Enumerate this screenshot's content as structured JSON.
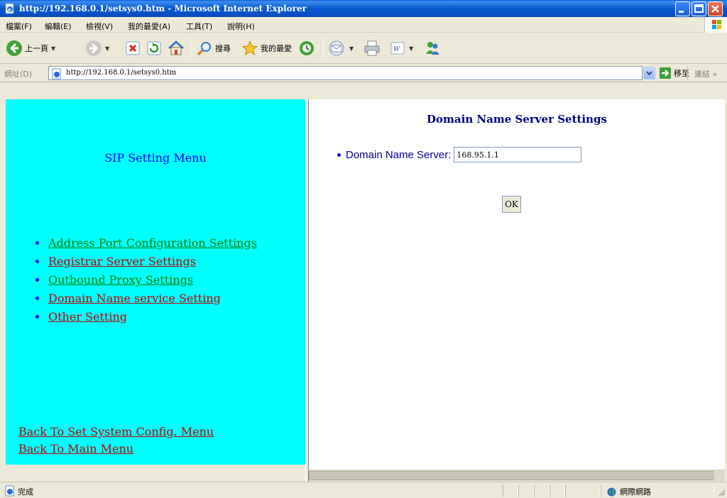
{
  "window": {
    "title": "http://192.168.0.1/setsys0.htm - Microsoft Internet Explorer",
    "title_icon": "ie-page-icon",
    "controls": [
      "minimize-icon",
      "maximize-icon",
      "close-icon"
    ]
  },
  "menubar": {
    "items": [
      "檔案(F)",
      "編輯(E)",
      "檢視(V)",
      "我的最愛(A)",
      "工具(T)",
      "說明(H)"
    ]
  },
  "toolbar": {
    "back_label": "上一頁",
    "search_label": "搜尋",
    "favorites_label": "我的最愛"
  },
  "addressbar": {
    "label": "網址(D)",
    "url": "http://192.168.0.1/setsys0.htm",
    "go_label": "移至",
    "links_label": "連結"
  },
  "left_frame": {
    "background": "#00ffff",
    "menu_title": "SIP Setting Menu",
    "nav_items": [
      {
        "label": "Address Port Configuration Settings",
        "color": "green"
      },
      {
        "label": "Registrar Server Settings",
        "color": "red"
      },
      {
        "label": "Outbound Proxy Settings",
        "color": "green"
      },
      {
        "label": "Domain Name service Setting",
        "color": "red"
      },
      {
        "label": "Other Setting",
        "color": "red"
      }
    ],
    "back_links": [
      "Back To Set System Config. Menu",
      "Back To Main Menu"
    ]
  },
  "right_frame": {
    "heading": "Domain Name Server Settings",
    "dns_label": "Domain Name Server:",
    "dns_value": "168.95.1.1",
    "ok_label": "OK"
  },
  "statusbar": {
    "text": "完成",
    "zone": "網際網路"
  }
}
